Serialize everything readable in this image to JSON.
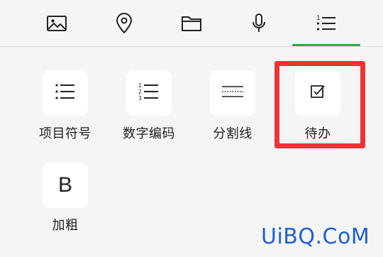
{
  "toolbar": {
    "tabs": [
      {
        "icon": "image-icon"
      },
      {
        "icon": "location-pin-icon"
      },
      {
        "icon": "folder-icon"
      },
      {
        "icon": "microphone-icon"
      },
      {
        "icon": "list-icon",
        "selected": true
      }
    ]
  },
  "format_items": [
    {
      "label": "项目符号",
      "icon": "bullet-list-icon"
    },
    {
      "label": "数字编码",
      "icon": "numbered-list-icon"
    },
    {
      "label": "分割线",
      "icon": "divider-icon"
    },
    {
      "label": "待办",
      "icon": "todo-checkbox-icon",
      "highlighted": true
    },
    {
      "label": "加粗",
      "icon": "bold-icon",
      "glyph": "B"
    }
  ],
  "colors": {
    "accent": "#2aa84a",
    "highlight": "#ee3238",
    "watermark": "#1f5fd6"
  },
  "watermark": "UiBQ.CoM"
}
